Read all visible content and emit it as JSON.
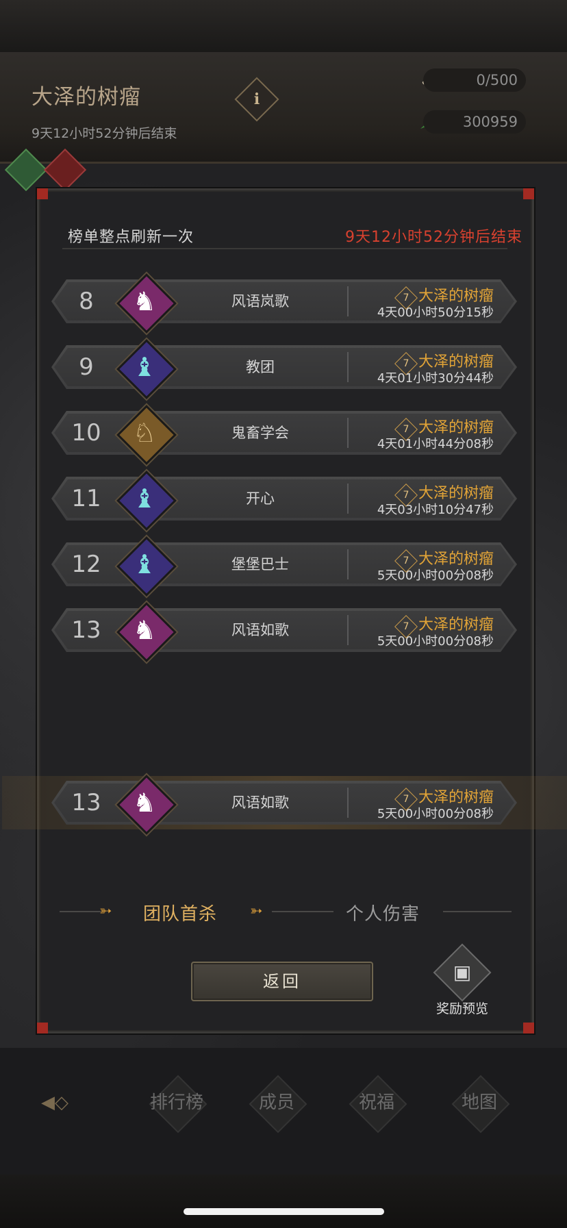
{
  "header": {
    "boss_title": "大泽的树瘤",
    "subtitle": "9天12小时52分钟后结束",
    "info_icon": "i",
    "resources": [
      {
        "icon": "drumstick-icon",
        "value": "0/500"
      },
      {
        "icon": "feather-icon",
        "value": "300959"
      }
    ]
  },
  "modal": {
    "refresh_note": "榜单整点刷新一次",
    "countdown": "9天12小时52分钟后结束",
    "rows": [
      {
        "rank": "8",
        "guild": "风语岚歌",
        "boss_level": "7",
        "boss": "大泽的树瘤",
        "time": "4天00小时50分15秒",
        "avatar": "purple-knight-icon",
        "avatar_color": "#7a2a6a"
      },
      {
        "rank": "9",
        "guild": "教团",
        "boss_level": "7",
        "boss": "大泽的树瘤",
        "time": "4天01小时30分44秒",
        "avatar": "blue-mage-icon",
        "avatar_color": "#3a2f7a"
      },
      {
        "rank": "10",
        "guild": "鬼畜学会",
        "boss_level": "7",
        "boss": "大泽的树瘤",
        "time": "4天01小时44分08秒",
        "avatar": "gold-unicorn-icon",
        "avatar_color": "#7a5a28"
      },
      {
        "rank": "11",
        "guild": "开心",
        "boss_level": "7",
        "boss": "大泽的树瘤",
        "time": "4天03小时10分47秒",
        "avatar": "blue-mage-icon",
        "avatar_color": "#3a2f7a"
      },
      {
        "rank": "12",
        "guild": "堡堡巴士",
        "boss_level": "7",
        "boss": "大泽的树瘤",
        "time": "5天00小时00分08秒",
        "avatar": "blue-mage-icon",
        "avatar_color": "#3a2f7a"
      },
      {
        "rank": "13",
        "guild": "风语如歌",
        "boss_level": "7",
        "boss": "大泽的树瘤",
        "time": "5天00小时00分08秒",
        "avatar": "purple-knight-icon",
        "avatar_color": "#7a2a6a"
      }
    ],
    "self_row": {
      "rank": "13",
      "guild": "风语如歌",
      "boss_level": "7",
      "boss": "大泽的树瘤",
      "time": "5天00小时00分08秒",
      "avatar": "purple-knight-icon",
      "avatar_color": "#7a2a6a"
    },
    "tabs": [
      {
        "label": "团队首杀",
        "active": true
      },
      {
        "label": "个人伤害",
        "active": false
      }
    ],
    "return_label": "返回",
    "reward_label": "奖励预览"
  },
  "bottom_nav": {
    "items": [
      "排行榜",
      "成员",
      "祝福",
      "地图"
    ]
  },
  "colors": {
    "accent": "#e2a437",
    "countdown": "#d8412f",
    "tab_active": "#e0b161"
  }
}
